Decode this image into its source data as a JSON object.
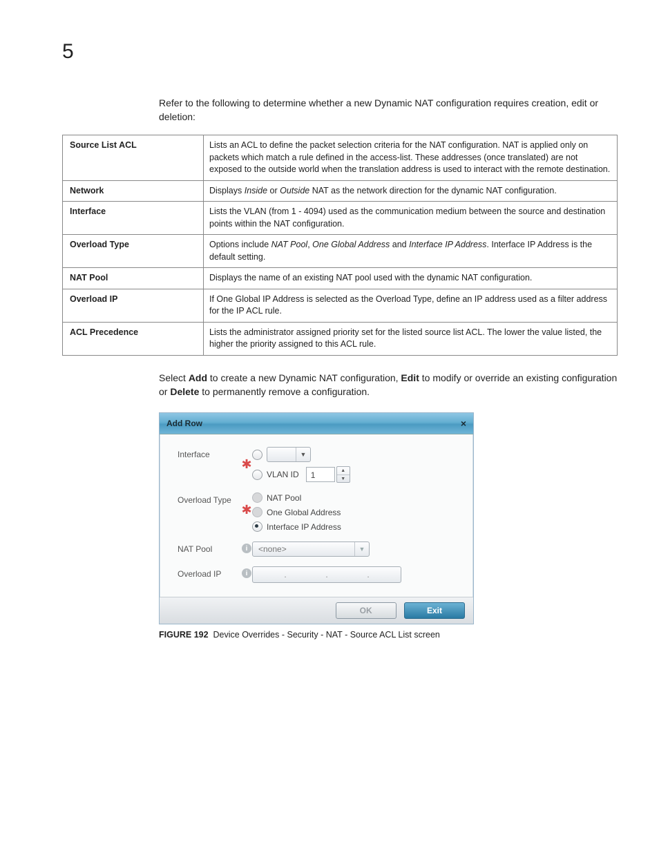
{
  "chapter": "5",
  "intro": "Refer to the following to determine whether a new Dynamic NAT configuration requires creation, edit or deletion:",
  "table": {
    "rows": [
      {
        "name": "Source List ACL",
        "desc": "Lists an ACL to define the packet selection criteria for the NAT configuration. NAT is applied only on packets which match a rule defined in the access-list. These addresses (once translated) are not exposed to the outside world when the translation address is used to interact with the remote destination."
      },
      {
        "name": "Network",
        "desc_html": "Displays <span class='italic'>Inside</span> or <span class='italic'>Outside</span> NAT as the network direction for the dynamic NAT configuration."
      },
      {
        "name": "Interface",
        "desc": "Lists the VLAN (from 1 - 4094) used as the communication medium between the source and destination points within the NAT configuration."
      },
      {
        "name": "Overload Type",
        "desc_html": "Options include <span class='italic'>NAT Pool</span>, <span class='italic'>One Global Address</span> and <span class='italic'>Interface IP Address</span>. Interface IP Address is the default setting."
      },
      {
        "name": "NAT Pool",
        "desc": "Displays the name of an existing NAT pool used with the dynamic NAT configuration."
      },
      {
        "name": "Overload IP",
        "desc": "If One Global IP Address is selected as the Overload Type, define an IP address used as a filter address for the IP ACL rule."
      },
      {
        "name": "ACL Precedence",
        "desc": "Lists the administrator assigned priority set for the listed source list ACL. The lower the value listed, the higher the priority assigned to this ACL rule."
      }
    ]
  },
  "para2_pre": "Select ",
  "para2_add": "Add",
  "para2_mid1": " to create a new Dynamic NAT configuration, ",
  "para2_edit": "Edit",
  "para2_mid2": " to modify or override an existing configuration or ",
  "para2_delete": "Delete",
  "para2_end": " to permanently remove a configuration.",
  "dialog": {
    "title": "Add Row",
    "close": "×",
    "labels": {
      "interface": "Interface",
      "vlanid": "VLAN ID",
      "vlan_value": "1",
      "overloadType": "Overload Type",
      "opt_natpool": "NAT Pool",
      "opt_oneglobal": "One Global Address",
      "opt_ifip": "Interface IP Address",
      "natpool": "NAT Pool",
      "natpool_value": "<none>",
      "overloadip": "Overload IP",
      "ip_dot": ".",
      "ok": "OK",
      "exit": "Exit"
    }
  },
  "figure": {
    "label": "FIGURE 192",
    "caption": "Device Overrides - Security - NAT - Source ACL List screen"
  }
}
